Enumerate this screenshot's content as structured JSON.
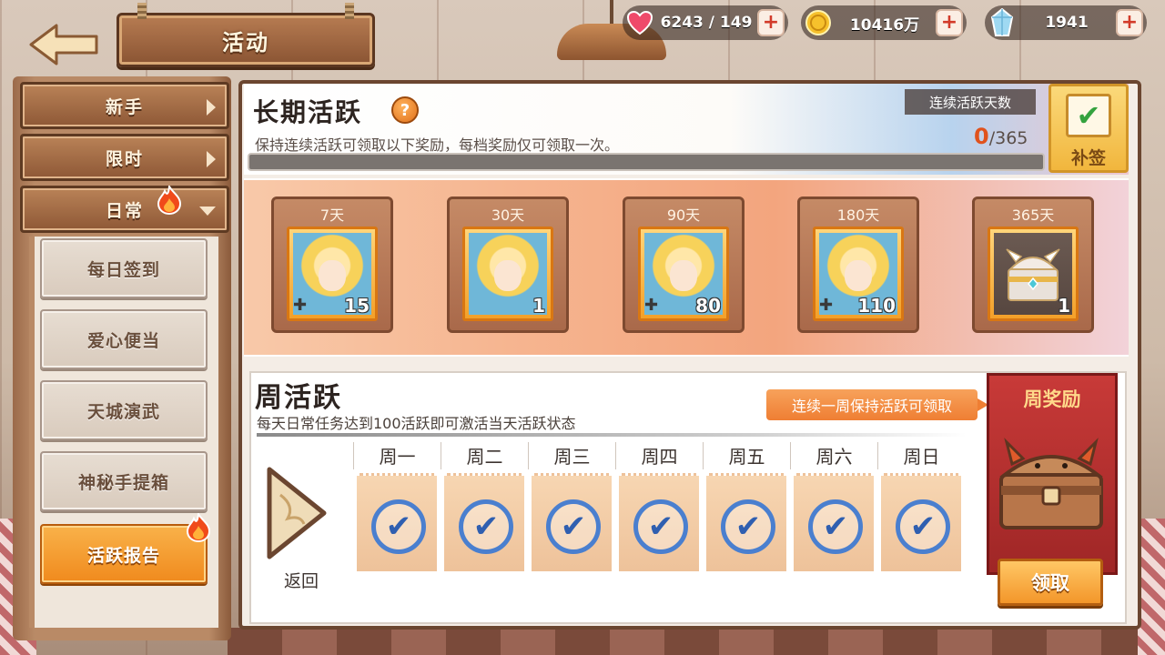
{
  "header": {
    "title": "活动",
    "currencies": [
      {
        "name": "heart",
        "icon": "heart-icon",
        "value": "6243 / 149",
        "plus": "+"
      },
      {
        "name": "gold",
        "icon": "gold-coin-icon",
        "value": "10416万",
        "plus": "+"
      },
      {
        "name": "gem",
        "icon": "crystal-icon",
        "value": "1941",
        "plus": "+"
      }
    ]
  },
  "sidebar": {
    "tabs": [
      {
        "label": "新手"
      },
      {
        "label": "限时"
      },
      {
        "label": "日常"
      }
    ],
    "items": [
      {
        "label": "每日签到"
      },
      {
        "label": "爱心便当"
      },
      {
        "label": "天城演武"
      },
      {
        "label": "神秘手提箱"
      },
      {
        "label": "活跃报告"
      }
    ]
  },
  "long_term": {
    "title": "长期活跃",
    "help": "?",
    "description": "保持连续活跃可领取以下奖励，每档奖励仅可领取一次。",
    "streak_label": "连续活跃天数",
    "streak_current": "0",
    "streak_total": "/365",
    "progress": 0,
    "makeup_label": "补签",
    "rewards": [
      {
        "day": "7天",
        "qty": "15",
        "type": "card"
      },
      {
        "day": "30天",
        "qty": "1",
        "type": "card"
      },
      {
        "day": "90天",
        "qty": "80",
        "type": "card"
      },
      {
        "day": "180天",
        "qty": "110",
        "type": "card"
      },
      {
        "day": "365天",
        "qty": "1",
        "type": "chest"
      }
    ]
  },
  "weekly": {
    "title": "周活跃",
    "description": "每天日常任务达到100活跃即可激活当天活跃状态",
    "hint": "连续一周保持活跃可领取",
    "back_label": "返回",
    "days": [
      "周一",
      "周二",
      "周三",
      "周四",
      "周五",
      "周六",
      "周日"
    ],
    "reward_title": "周奖励",
    "claim_label": "领取"
  },
  "colors": {
    "accent": "#f3962a",
    "panel_border": "#6b4630",
    "check": "#4a7fcf"
  }
}
